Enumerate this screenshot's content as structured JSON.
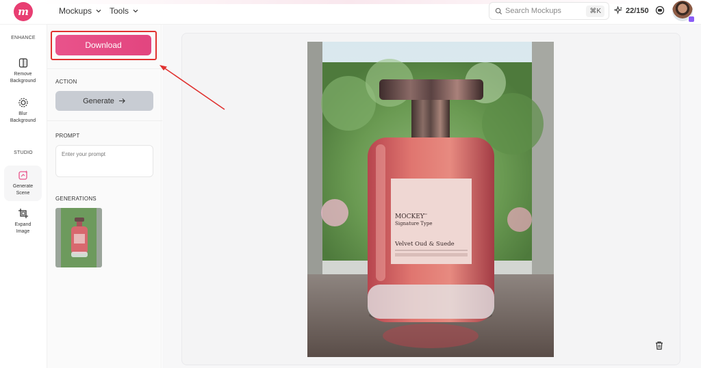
{
  "header": {
    "logo_text": "m",
    "nav": [
      {
        "label": "Mockups"
      },
      {
        "label": "Tools"
      }
    ],
    "search": {
      "placeholder": "Search Mockups",
      "shortcut": "⌘K"
    },
    "credits": "22/150",
    "colors": {
      "brand": "#e83e72",
      "accent": "#e9538b"
    }
  },
  "sidebar": {
    "sections": [
      {
        "title": "ENHANCE"
      },
      {
        "title": "STUDIO"
      }
    ],
    "items": [
      {
        "label_line1": "Remove",
        "label_line2": "Background",
        "icon": "remove-background-icon"
      },
      {
        "label_line1": "Blur",
        "label_line2": "Background",
        "icon": "blur-background-icon"
      },
      {
        "label_line1": "Generate",
        "label_line2": "Scene",
        "icon": "generate-scene-icon",
        "active": true
      },
      {
        "label_line1": "Expand",
        "label_line2": "Image",
        "icon": "expand-image-icon"
      }
    ]
  },
  "panel": {
    "download_label": "Download",
    "action_title": "ACTION",
    "generate_label": "Generate",
    "prompt_title": "PROMPT",
    "prompt_placeholder": "Enter your prompt",
    "generations_title": "GENERATIONS"
  },
  "canvas": {
    "label": {
      "brand": "MOCKEY",
      "brand_mark": "co",
      "subtitle": "Signature Type",
      "product": "Velvet Oud & Suede"
    }
  }
}
